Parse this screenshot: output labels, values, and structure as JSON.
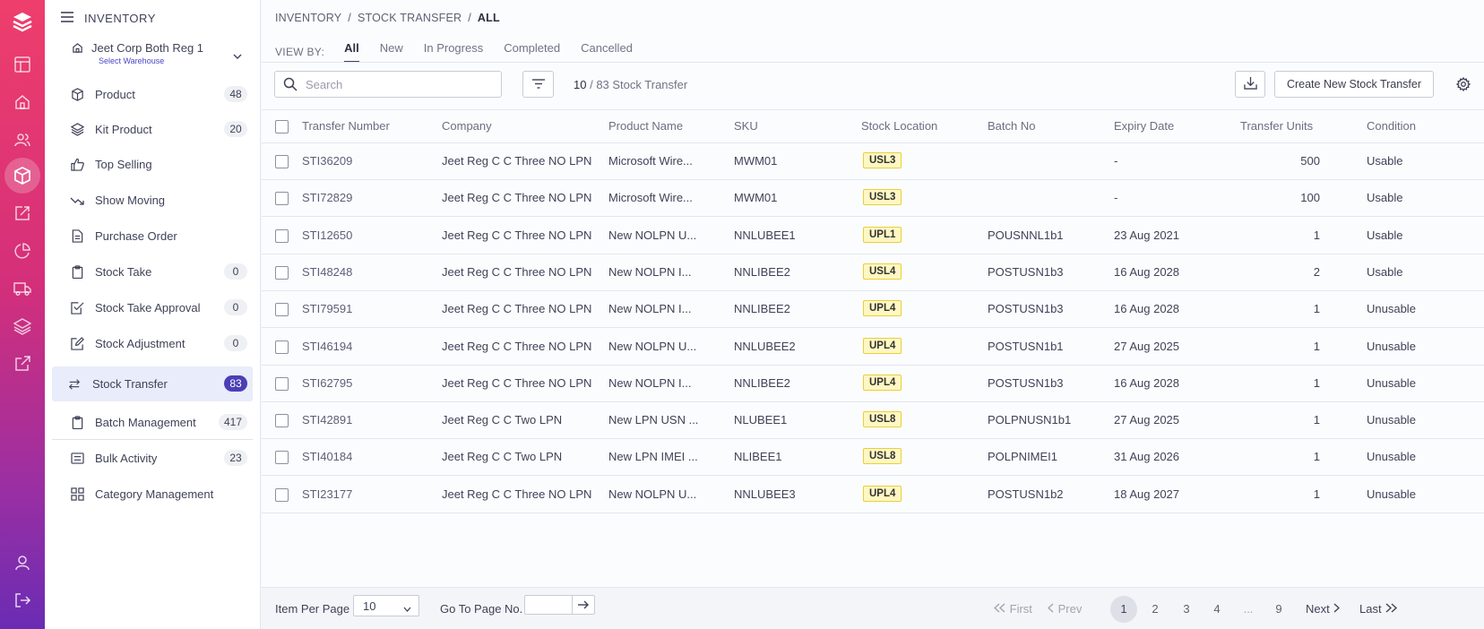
{
  "app": {
    "accent": "#ee3e6b",
    "accent_dark": "#6a2cb4"
  },
  "rail": {
    "icons": [
      "logo-icon",
      "layout-icon",
      "home-icon",
      "users-icon",
      "box-icon",
      "edit-icon",
      "pie-chart-icon",
      "truck-icon",
      "layers-icon",
      "external-link-icon",
      "user-icon",
      "logout-icon"
    ],
    "active": "box-icon"
  },
  "sidebar": {
    "title": "INVENTORY",
    "warehouse": {
      "name": "Jeet Corp Both Reg 1",
      "sub": "Select Warehouse"
    },
    "items": [
      {
        "label": "Product",
        "badge": "48",
        "icon": "box-icon"
      },
      {
        "label": "Kit Product",
        "badge": "20",
        "icon": "layers-icon"
      },
      {
        "label": "Top Selling",
        "badge": "",
        "icon": "thumbs-up-icon"
      },
      {
        "label": "Show Moving",
        "badge": "",
        "icon": "trend-down-icon"
      },
      {
        "label": "Purchase Order",
        "badge": "",
        "icon": "document-icon"
      },
      {
        "label": "Stock Take",
        "badge": "0",
        "icon": "clipboard-icon"
      },
      {
        "label": "Stock Take Approval",
        "badge": "0",
        "icon": "check-square-icon"
      },
      {
        "label": "Stock Adjustment",
        "badge": "0",
        "icon": "pencil-square-icon"
      },
      {
        "label": "Stock Transfer",
        "badge": "83",
        "icon": "transfer-icon",
        "active": true
      },
      {
        "label": "Batch Management",
        "badge": "417",
        "icon": "clipboard-icon"
      },
      {
        "label": "Bulk Activity",
        "badge": "23",
        "icon": "list-icon"
      },
      {
        "label": "Category Management",
        "badge": "",
        "icon": "grid-icon"
      }
    ]
  },
  "breadcrumb": [
    "INVENTORY",
    "STOCK TRANSFER",
    "ALL"
  ],
  "viewby": {
    "label": "VIEW BY:",
    "tabs": [
      "All",
      "New",
      "In Progress",
      "Completed",
      "Cancelled"
    ],
    "active": "All"
  },
  "toolbar": {
    "search_placeholder": "Search",
    "count_shown": "10",
    "count_total": "/ 83 Stock Transfer",
    "create_label": "Create New Stock Transfer"
  },
  "table": {
    "headers": [
      "Transfer Number",
      "Company",
      "Product Name",
      "SKU",
      "Stock Location",
      "Batch No",
      "Expiry Date",
      "Transfer Units",
      "Condition"
    ],
    "rows": [
      [
        "STI36209",
        "Jeet Reg C C Three NO LPN",
        "Microsoft Wire...",
        "MWM01",
        "USL3",
        "",
        "-",
        "500",
        "Usable"
      ],
      [
        "STI72829",
        "Jeet Reg C C Three NO LPN",
        "Microsoft Wire...",
        "MWM01",
        "USL3",
        "",
        "-",
        "100",
        "Usable"
      ],
      [
        "STI12650",
        "Jeet Reg C C Three NO LPN",
        "New NOLPN U...",
        "NNLUBEE1",
        "UPL1",
        "POUSNNL1b1",
        "23 Aug 2021",
        "1",
        "Usable"
      ],
      [
        "STI48248",
        "Jeet Reg C C Three NO LPN",
        "New NOLPN I...",
        "NNLIBEE2",
        "USL4",
        "POSTUSN1b3",
        "16 Aug 2028",
        "2",
        "Usable"
      ],
      [
        "STI79591",
        "Jeet Reg C C Three NO LPN",
        "New NOLPN I...",
        "NNLIBEE2",
        "UPL4",
        "POSTUSN1b3",
        "16 Aug 2028",
        "1",
        "Unusable"
      ],
      [
        "STI46194",
        "Jeet Reg C C Three NO LPN",
        "New NOLPN U...",
        "NNLUBEE2",
        "UPL4",
        "POSTUSN1b1",
        "27 Aug 2025",
        "1",
        "Unusable"
      ],
      [
        "STI62795",
        "Jeet Reg C C Three NO LPN",
        "New NOLPN I...",
        "NNLIBEE2",
        "UPL4",
        "POSTUSN1b3",
        "16 Aug 2028",
        "1",
        "Unusable"
      ],
      [
        "STI42891",
        "Jeet Reg C C Two LPN",
        "New LPN USN ...",
        "NLUBEE1",
        "USL8",
        "POLPNUSN1b1",
        "27 Aug 2025",
        "1",
        "Unusable"
      ],
      [
        "STI40184",
        "Jeet Reg C C Two LPN",
        "New LPN IMEI ...",
        "NLIBEE1",
        "USL8",
        "POLPNIMEI1",
        "31 Aug 2026",
        "1",
        "Unusable"
      ],
      [
        "STI23177",
        "Jeet Reg C C Three NO LPN",
        "New NOLPN U...",
        "NNLUBEE3",
        "UPL4",
        "POSTUSN1b2",
        "18 Aug 2027",
        "1",
        "Unusable"
      ]
    ]
  },
  "footer": {
    "per_page_label": "Item Per Page",
    "per_page_value": "10",
    "goto_label": "Go To Page No.",
    "first": "First",
    "prev": "Prev",
    "pages": [
      "1",
      "2",
      "3",
      "4",
      "...",
      "9"
    ],
    "current_page": "1",
    "next": "Next",
    "last": "Last"
  }
}
